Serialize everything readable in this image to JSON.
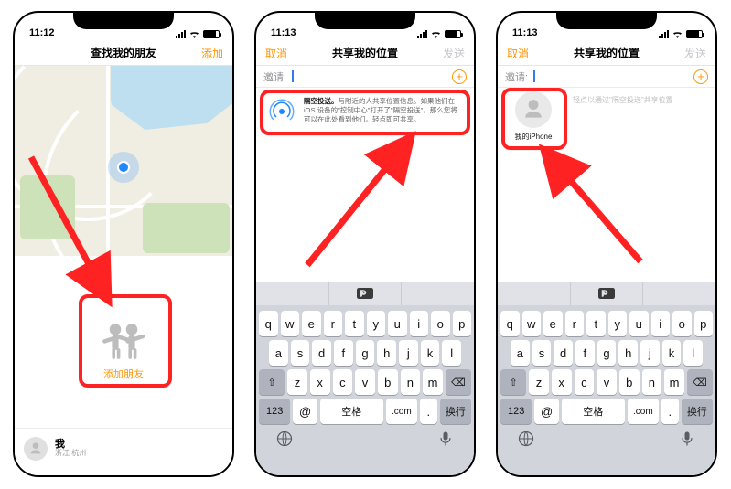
{
  "status": {
    "time1": "11:12",
    "time2": "11:13",
    "time3": "11:13",
    "signal": "signal-4",
    "wifi": "wifi-icon",
    "battery": "battery-80"
  },
  "nav": {
    "title1": "查找我的朋友",
    "title_share": "共享我的位置",
    "right1": "添加",
    "left_cancel": "取消",
    "right_send": "发送"
  },
  "panel1": {
    "add_friend": "添加朋友",
    "me_name": "我",
    "me_location": "浙江 杭州"
  },
  "invite": {
    "label": "邀请:",
    "plus": "+"
  },
  "card2": {
    "title": "隔空投送。",
    "body": "与附近的人共享位置信息。如果他们在 iOS 设备的\"控制中心\"打开了\"隔空投送\"，那么您将可以在此处看到他们。轻点即可共享。"
  },
  "card3": {
    "contact_name": "我的iPhone",
    "hint": "轻点以通过\"隔空投送\"共享位置"
  },
  "keyboard": {
    "suggest": [
      "",
      "S",
      ""
    ],
    "row1": [
      "q",
      "w",
      "e",
      "r",
      "t",
      "y",
      "u",
      "i",
      "o",
      "p"
    ],
    "row2": [
      "a",
      "s",
      "d",
      "f",
      "g",
      "h",
      "j",
      "k",
      "l"
    ],
    "shift": "⇧",
    "row3": [
      "z",
      "x",
      "c",
      "v",
      "b",
      "n",
      "m"
    ],
    "backspace": "⌫",
    "numkey": "123",
    "at": "@",
    "space": "空格",
    "dotcom": ".com",
    "dot": ".",
    "return": "换行"
  }
}
